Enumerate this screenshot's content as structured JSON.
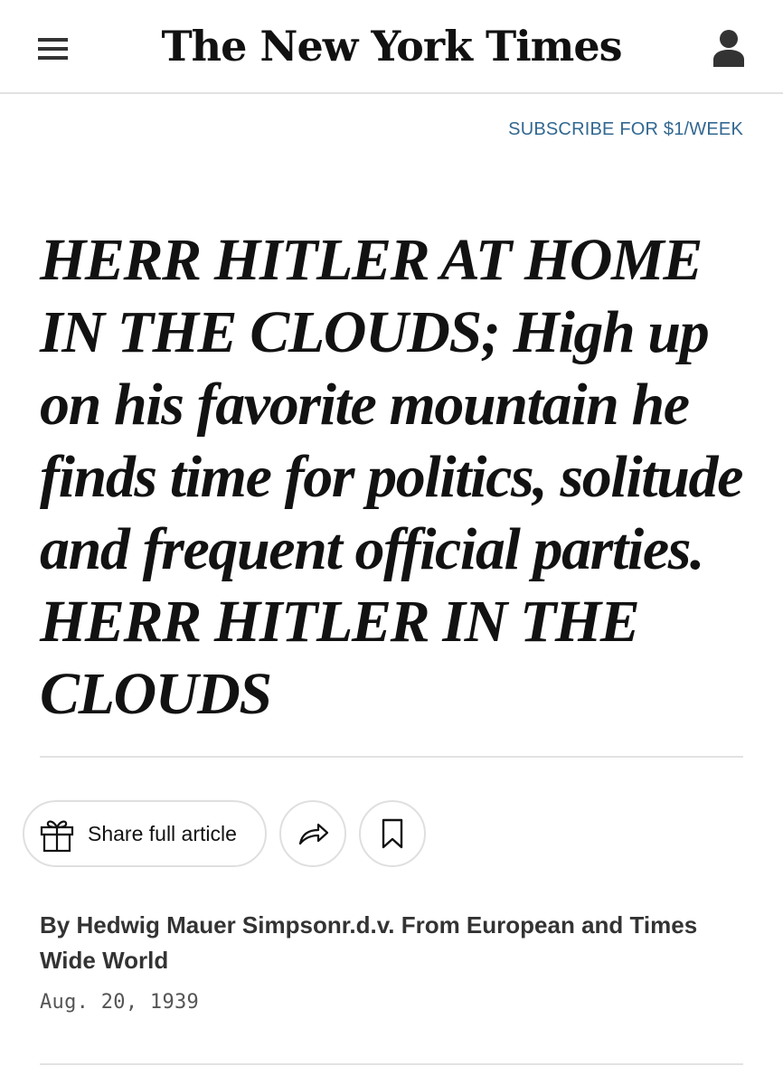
{
  "header": {
    "logo_text": "The New York Times",
    "menu_icon": "hamburger-menu-icon",
    "account_icon": "user-account-icon"
  },
  "subscribe": {
    "label": "SUBSCRIBE FOR $1/WEEK"
  },
  "article": {
    "headline": "HERR HITLER AT HOME IN THE CLOUDS; High up on his favorite mountain he finds time for politics, solitude and frequent official parties. HERR HITLER IN THE CLOUDS",
    "byline": "By Hedwig Mauer Simpsonr.d.v. From European and Times Wide World",
    "date": "Aug. 20, 1939"
  },
  "actions": {
    "share_full_label": "Share full article",
    "gift_icon": "gift-icon",
    "share_icon": "share-arrow-icon",
    "save_icon": "bookmark-icon"
  },
  "colors": {
    "text": "#121212",
    "link_blue": "#326891",
    "divider": "#e2e2e2",
    "button_border": "#dfdfdf"
  }
}
